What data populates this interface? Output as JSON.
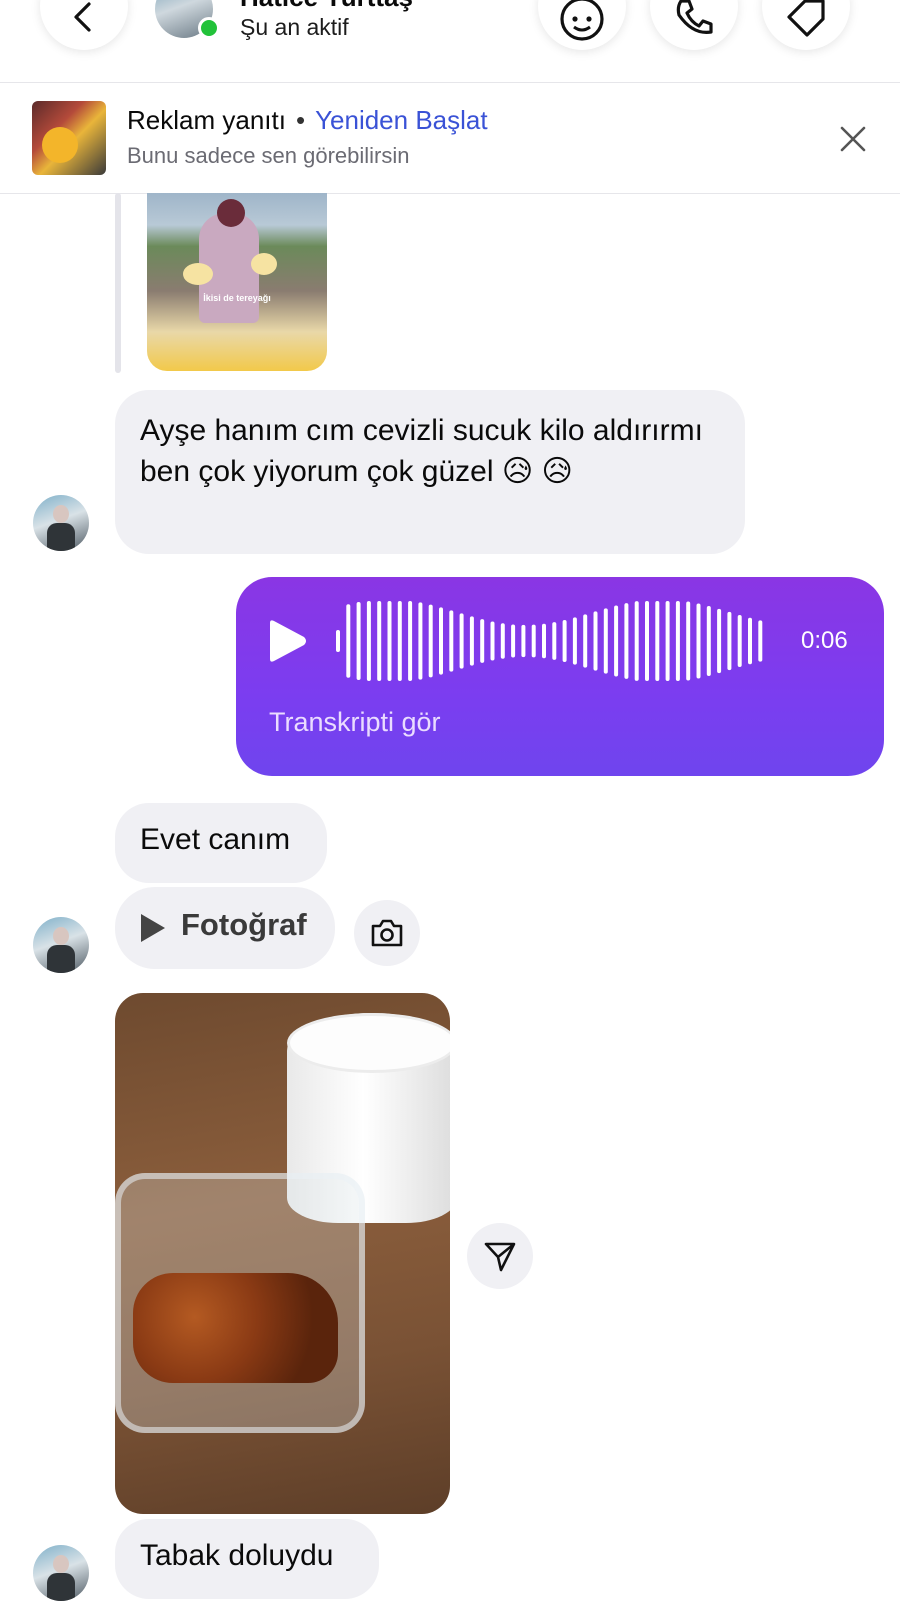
{
  "header": {
    "contact_name": "Hatice Yurttaş",
    "status": "Şu an aktif",
    "buttons": [
      "back-icon",
      "avatar-emoji-icon",
      "phone-icon",
      "tag-icon"
    ],
    "online_color": "#22c23a"
  },
  "ad_bar": {
    "label": "Reklam yanıtı",
    "separator": "•",
    "restart": "Yeniden Başlat",
    "note": "Bunu sadece sen görebilirsin",
    "restart_color": "#3a52d6"
  },
  "reply_preview": {
    "caption": "İkisi de tereyağı"
  },
  "messages": {
    "m1": "Ayşe hanım cım cevizli sucuk kilo aldırırmı ben çok yiyorum çok güzel 😥 😥",
    "voice": {
      "duration": "0:06",
      "transcript_link": "Transkripti gör",
      "color": "#7b3df0"
    },
    "m2": "Evet canım",
    "photo_chip_label": "Fotoğraf",
    "m3": "Tabak doluydu"
  }
}
